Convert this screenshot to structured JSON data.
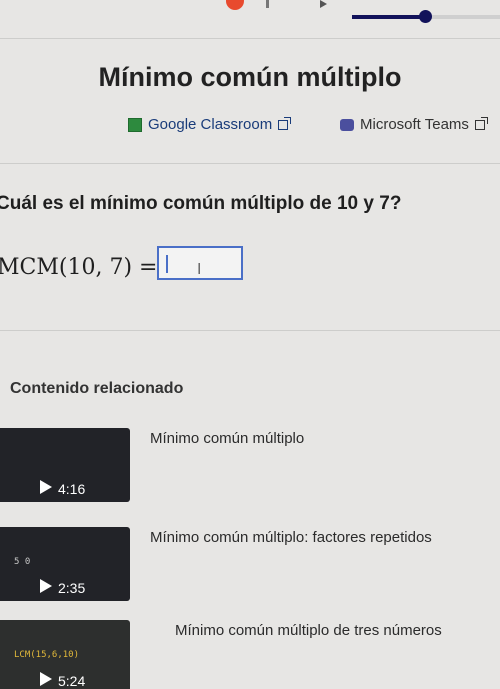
{
  "toolbar": {
    "top_mark": "1",
    "progress": 0.52
  },
  "title": "Mínimo común múltiplo",
  "share": {
    "google_classroom": "Google Classroom",
    "microsoft_teams": "Microsoft Teams"
  },
  "question": "Cuál es el mínimo común múltiplo de 10 y 7?",
  "expression": "MCM(10, 7) =",
  "answer": {
    "value": ""
  },
  "related": {
    "heading": "Contenido relacionado",
    "videos": [
      {
        "title": "Mínimo común múltiplo",
        "duration": "4:16",
        "thumb_text": ""
      },
      {
        "title": "Mínimo común múltiplo: factores repetidos",
        "duration": "2:35",
        "thumb_text": "5 0"
      },
      {
        "title": "Mínimo común múltiplo de tres números",
        "duration": "5:24",
        "thumb_text": "LCM(15,6,10)"
      }
    ]
  },
  "colors": {
    "accent": "#4a6fc7",
    "progress": "#12125a",
    "badge": "#e84a2e"
  }
}
